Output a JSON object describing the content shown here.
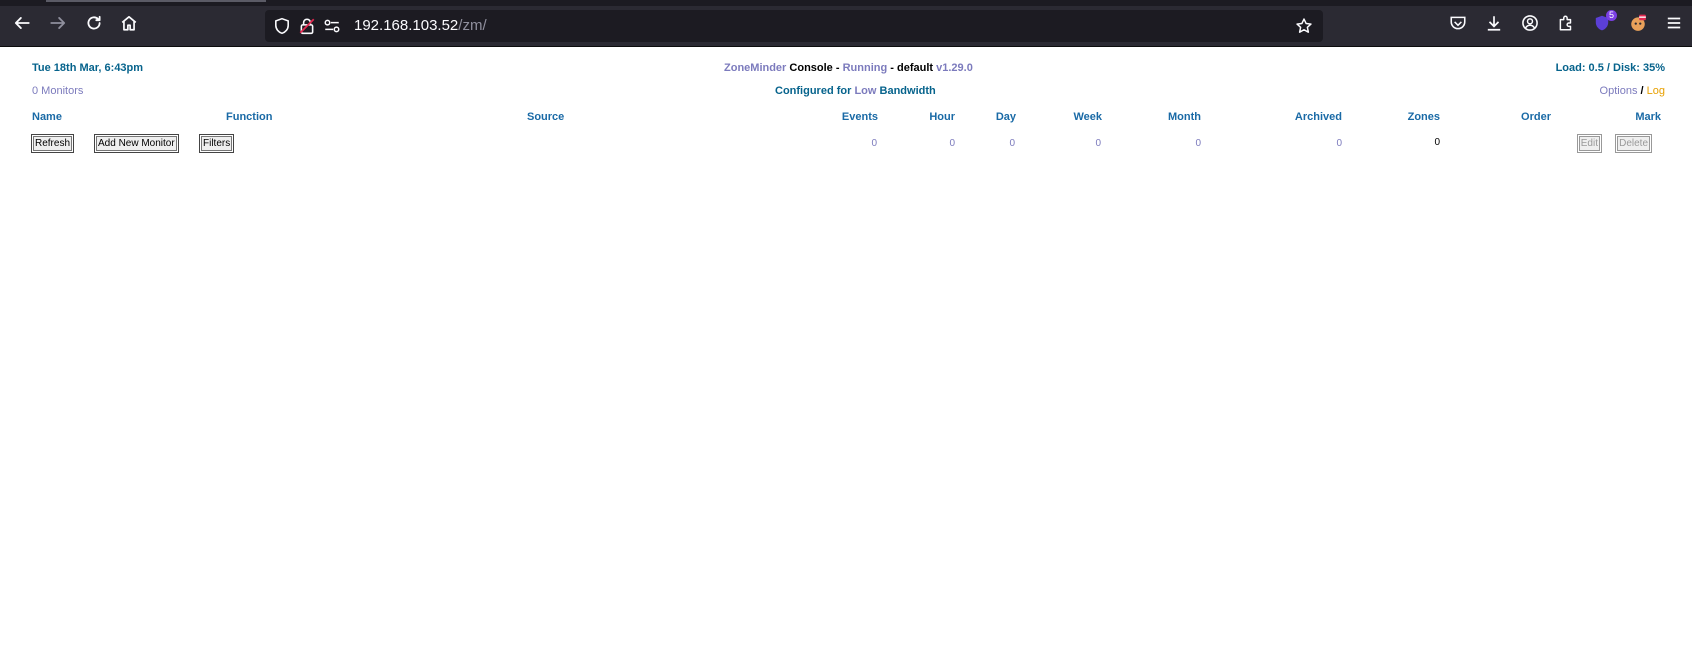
{
  "browser": {
    "url_host": "192.168.103.52",
    "url_path": "/zm/",
    "extension_badge": "5"
  },
  "header": {
    "datetime": "Tue 18th Mar, 6:43pm",
    "brand": "ZoneMinder",
    "console": "Console",
    "sep1": "-",
    "state": "Running",
    "sep2": "-",
    "profile": "default",
    "version": "v1.29.0",
    "load": "Load: 0.5 / Disk: 35%",
    "monitors": "0 Monitors",
    "configured_prefix": "Configured for",
    "bandwidth_level": "Low",
    "bandwidth_suffix": "Bandwidth",
    "options": "Options",
    "slash": "/",
    "log": "Log"
  },
  "table": {
    "headers": {
      "name": "Name",
      "function": "Function",
      "source": "Source",
      "events": "Events",
      "hour": "Hour",
      "day": "Day",
      "week": "Week",
      "month": "Month",
      "archived": "Archived",
      "zones": "Zones",
      "order": "Order",
      "mark": "Mark"
    },
    "footer": {
      "refresh": "Refresh",
      "add_new_monitor": "Add New Monitor",
      "filters": "Filters",
      "events": "0",
      "hour": "0",
      "day": "0",
      "week": "0",
      "month": "0",
      "archived": "0",
      "zones": "0",
      "edit": "Edit",
      "delete": "Delete"
    }
  }
}
